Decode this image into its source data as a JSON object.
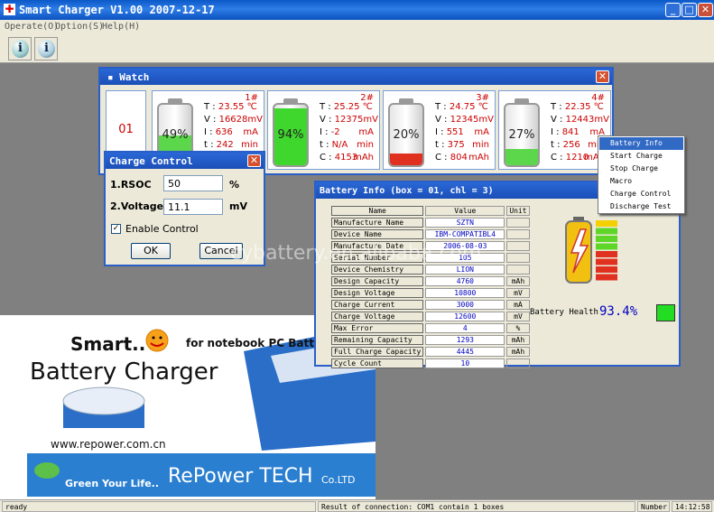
{
  "app": {
    "title": "Smart Charger V1.00 2007-12-17",
    "controls": [
      "_",
      "□",
      "✕"
    ]
  },
  "menu": [
    "Operate(O)",
    "Option(S)",
    "Help(H)"
  ],
  "toolbar": [
    {
      "icon": "info-icon"
    },
    {
      "icon": "about-icon"
    }
  ],
  "watch": {
    "title": "Watch",
    "channel": "01",
    "slots": [
      {
        "num": "1#",
        "pct": "49%",
        "level": 0.49,
        "color": "#5cd64a",
        "T": "23.55 ℃",
        "V": "16628mV",
        "I": "636",
        "t": "242",
        "C": null
      },
      {
        "num": "2#",
        "pct": "94%",
        "level": 0.94,
        "color": "#3fd62e",
        "T": "25.25 ℃",
        "V": "12375mV",
        "I": "-2",
        "t": "N/A",
        "C": "4153"
      },
      {
        "num": "3#",
        "pct": "20%",
        "level": 0.2,
        "color": "#e03020",
        "T": "24.75 ℃",
        "V": "12345mV",
        "I": "551",
        "t": "375",
        "C": "804"
      },
      {
        "num": "4#",
        "pct": "27%",
        "level": 0.27,
        "color": "#5cd64a",
        "T": "22.35 ℃",
        "V": "12443mV",
        "I": "841",
        "t": "256",
        "C": "1210"
      }
    ],
    "labels": {
      "T": "T :",
      "V": "V :",
      "I": "I :",
      "t": "t :",
      "C": "C :",
      "mA": "mA",
      "min": "min",
      "mAh": "mAh"
    }
  },
  "charge_control": {
    "title": "Charge Control",
    "rsoc_label": "1.RSOC",
    "rsoc_value": "50",
    "rsoc_unit": "%",
    "voltage_label": "2.Voltage",
    "voltage_value": "11.1",
    "voltage_unit": "mV",
    "enable_label": "Enable Control",
    "enable_checked": true,
    "ok": "OK",
    "cancel": "Cancel"
  },
  "battery_info": {
    "title": "Battery Info (box = 01, chl = 3)",
    "headers": [
      "Name",
      "Value",
      "Unit"
    ],
    "rows": [
      [
        "Manufacture Name",
        "SZTN",
        ""
      ],
      [
        "Device Name",
        "IBM-COMPATIBL4",
        ""
      ],
      [
        "Manufacture Date",
        "2006-08-03",
        ""
      ],
      [
        "Serial Number",
        "105",
        ""
      ],
      [
        "Device Chemistry",
        "LION",
        ""
      ],
      [
        "Design Capacity",
        "4760",
        "mAh"
      ],
      [
        "Design Voltage",
        "10800",
        "mV"
      ],
      [
        "Charge Current",
        "3000",
        "mA"
      ],
      [
        "Charge Voltage",
        "12600",
        "mV"
      ],
      [
        "Max Error",
        "4",
        "%"
      ],
      [
        "Remaining Capacity",
        "1293",
        "mAh"
      ],
      [
        "Full Charge Capacity",
        "4445",
        "mAh"
      ],
      [
        "Cycle Count",
        "10",
        ""
      ]
    ],
    "health_label": "Battery Health",
    "health_value": "93.4%",
    "health_color": "#22dd22"
  },
  "context_menu": [
    "Battery Info",
    "Start Charge",
    "Stop Charge",
    "Macro",
    "Charge Control",
    "Discharge Test"
  ],
  "ad": {
    "smart": "Smart..",
    "for": "for notebook PC Battery",
    "title": "Battery Charger",
    "url": "www.repower.com.cn",
    "green": "Green Your Life..",
    "brand": "RePower TECH",
    "co": "Co.LTD"
  },
  "watermark": "cybattery.en.alibaba.com",
  "status": {
    "left": "ready",
    "conn": "Result of connection: COM1 contain 1 boxes",
    "num": "Number",
    "time": "14:12:58"
  }
}
